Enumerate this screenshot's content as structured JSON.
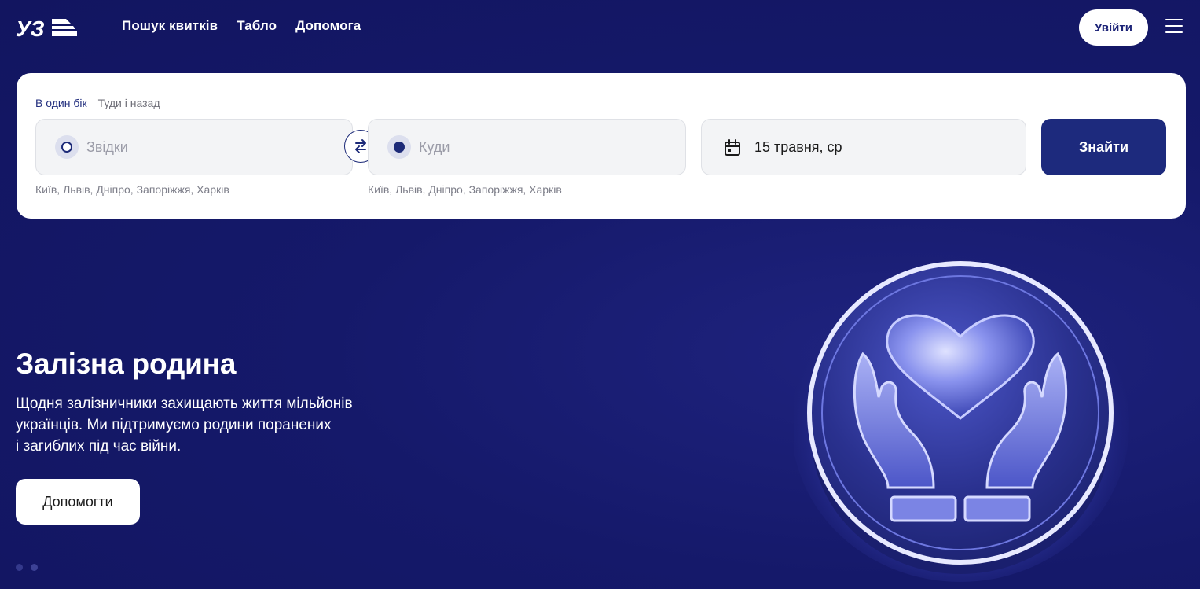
{
  "header": {
    "logo_text": "УЗ",
    "nav": [
      "Пошук квитків",
      "Табло",
      "Допомога"
    ],
    "login_label": "Увійти"
  },
  "search": {
    "trip_types": [
      "В один бік",
      "Туди і назад"
    ],
    "from_placeholder": "Звідки",
    "to_placeholder": "Куди",
    "from_hint": "Київ, Львів, Дніпро, Запоріжжя, Харків",
    "to_hint": "Київ, Львів, Дніпро, Запоріжжя, Харків",
    "date": "15 травня, ср",
    "search_label": "Знайти"
  },
  "hero": {
    "title": "Залізна родина",
    "text": "Щодня залізничники захищають життя мільйонів\nукраїнців. Ми підтримуємо родини поранених\nі загиблих під час війни.",
    "button_label": "Допомогти",
    "slides_count": 2,
    "active_slide": 1
  },
  "icons": {
    "menu": "hamburger-menu-icon",
    "swap": "swap-arrows-icon",
    "calendar": "calendar-icon",
    "emblem": "heart-in-hands-icon"
  },
  "colors": {
    "background": "#15196a",
    "accent": "#1d2a7d",
    "card": "#ffffff"
  }
}
